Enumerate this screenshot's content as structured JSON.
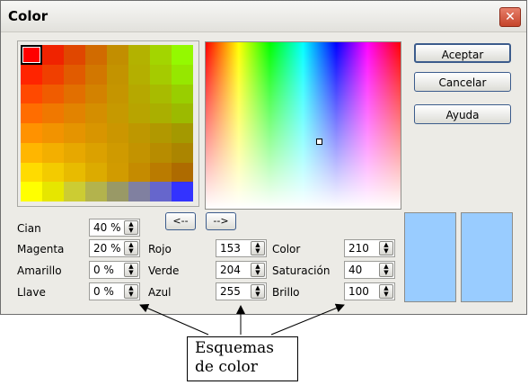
{
  "window": {
    "title": "Color",
    "close_glyph": "✕"
  },
  "buttons": {
    "ok": "Aceptar",
    "cancel": "Cancelar",
    "help": "Ayuda",
    "left_arrow": "<--",
    "right_arrow": "-->"
  },
  "swatch_colors": [
    [
      "#ff0000",
      "#f02300",
      "#e04700",
      "#d16b00",
      "#c28e00",
      "#b3b200",
      "#a3d500",
      "#94f900"
    ],
    [
      "#ff2400",
      "#f03f00",
      "#e15b00",
      "#d27700",
      "#c39300",
      "#b4af00",
      "#a5cb00",
      "#96e700"
    ],
    [
      "#ff4900",
      "#f05c00",
      "#e26f00",
      "#d38200",
      "#c59500",
      "#b6a800",
      "#a8bb00",
      "#99ce00"
    ],
    [
      "#ff6d00",
      "#f07800",
      "#e28300",
      "#d48e00",
      "#c69900",
      "#b8a400",
      "#aaaf00",
      "#9cba00"
    ],
    [
      "#ff9200",
      "#f29300",
      "#e59400",
      "#d89500",
      "#cb9600",
      "#be9700",
      "#b19800",
      "#a49900"
    ],
    [
      "#ffb600",
      "#f3af00",
      "#e7a800",
      "#dba100",
      "#cf9a00",
      "#c39300",
      "#b78c00",
      "#ab8500"
    ],
    [
      "#ffdb00",
      "#f3cb00",
      "#e8bb00",
      "#dcab00",
      "#d19b00",
      "#c58b00",
      "#ba7b00",
      "#ae6b00"
    ],
    [
      "#ffff00",
      "#e6e600",
      "#cccc33",
      "#b3b34d",
      "#999966",
      "#8080a0",
      "#6666cc",
      "#3333ff"
    ]
  ],
  "cmyk": {
    "cyan": {
      "label": "Cian",
      "value": "40 %"
    },
    "magenta": {
      "label": "Magenta",
      "value": "20 %"
    },
    "yellow": {
      "label": "Amarillo",
      "value": "0 %"
    },
    "key": {
      "label": "Llave",
      "value": "0 %"
    }
  },
  "rgb": {
    "red": {
      "label": "Rojo",
      "value": "153"
    },
    "green": {
      "label": "Verde",
      "value": "204"
    },
    "blue": {
      "label": "Azul",
      "value": "255"
    }
  },
  "hsb": {
    "hue": {
      "label": "Color",
      "value": "210"
    },
    "saturation": {
      "label": "Saturación",
      "value": "40"
    },
    "brightness": {
      "label": "Brillo",
      "value": "100"
    }
  },
  "preview": {
    "original_color": "#99ccff",
    "new_color": "#99ccff"
  },
  "annotation": {
    "line1": "Esquemas",
    "line2": "de color"
  }
}
